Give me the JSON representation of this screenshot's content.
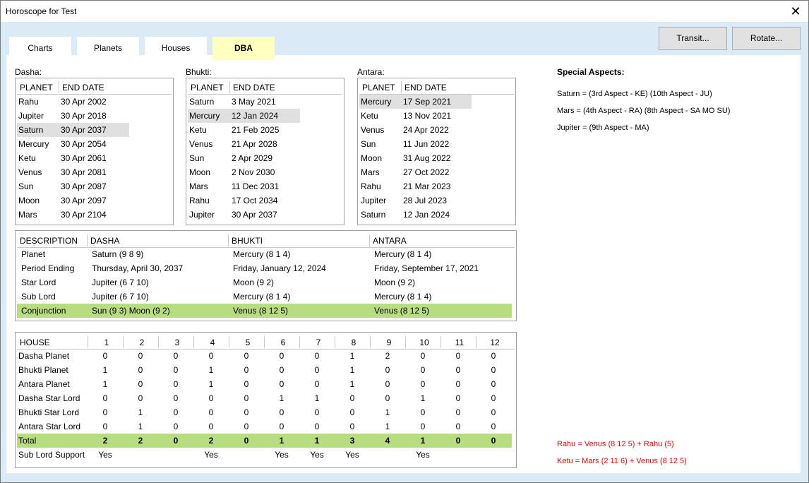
{
  "window": {
    "title": "Horoscope for Test",
    "close_icon": "close-icon"
  },
  "tabs": [
    {
      "label": "Charts"
    },
    {
      "label": "Planets"
    },
    {
      "label": "Houses"
    },
    {
      "label": "DBA",
      "active": true
    }
  ],
  "buttons": {
    "transit": "Transit...",
    "rotate": "Rotate..."
  },
  "colors": {
    "active_tab": "#ffffc0",
    "highlight_row": "#b8dc80",
    "selected_row": "#e0e0e0",
    "conjunction_text": "#ff0000"
  },
  "lists": [
    {
      "label": "Dasha:",
      "col1": "PLANET",
      "col2": "END DATE",
      "selected": 2,
      "rows": [
        [
          "Rahu",
          "30 Apr 2002"
        ],
        [
          "Jupiter",
          "30 Apr 2018"
        ],
        [
          "Saturn",
          "30 Apr 2037"
        ],
        [
          "Mercury",
          "30 Apr 2054"
        ],
        [
          "Ketu",
          "30 Apr 2061"
        ],
        [
          "Venus",
          "30 Apr 2081"
        ],
        [
          "Sun",
          "30 Apr 2087"
        ],
        [
          "Moon",
          "30 Apr 2097"
        ],
        [
          "Mars",
          "30 Apr 2104"
        ]
      ]
    },
    {
      "label": "Bhukti:",
      "col1": "PLANET",
      "col2": "END DATE",
      "selected": 1,
      "rows": [
        [
          "Saturn",
          "3 May 2021"
        ],
        [
          "Mercury",
          "12 Jan 2024"
        ],
        [
          "Ketu",
          "21 Feb 2025"
        ],
        [
          "Venus",
          "21 Apr 2028"
        ],
        [
          "Sun",
          "2 Apr 2029"
        ],
        [
          "Moon",
          "2 Nov 2030"
        ],
        [
          "Mars",
          "11 Dec 2031"
        ],
        [
          "Rahu",
          "17 Oct 2034"
        ],
        [
          "Jupiter",
          "30 Apr 2037"
        ]
      ]
    },
    {
      "label": "Antara:",
      "col1": "PLANET",
      "col2": "END DATE",
      "selected": 0,
      "rows": [
        [
          "Mercury",
          "17 Sep 2021"
        ],
        [
          "Ketu",
          "13 Nov 2021"
        ],
        [
          "Venus",
          "24 Apr 2022"
        ],
        [
          "Sun",
          "11 Jun 2022"
        ],
        [
          "Moon",
          "31 Aug 2022"
        ],
        [
          "Mars",
          "27 Oct 2022"
        ],
        [
          "Rahu",
          "21 Mar 2023"
        ],
        [
          "Jupiter",
          "28 Jul 2023"
        ],
        [
          "Saturn",
          "12 Jan 2024"
        ]
      ]
    }
  ],
  "description": {
    "headers": [
      "DESCRIPTION",
      "DASHA",
      "BHUKTI",
      "ANTARA"
    ],
    "rows": [
      [
        "Planet",
        "Saturn (9 8 9)",
        "Mercury (8 1 4)",
        "Mercury (8 1 4)"
      ],
      [
        "Period Ending",
        "Thursday, April 30, 2037",
        "Friday, January 12, 2024",
        "Friday, September 17, 2021"
      ],
      [
        "Star Lord",
        "Jupiter (6 7 10)",
        "Moon (9 2)",
        "Moon (9 2)"
      ],
      [
        "Sub Lord",
        "Jupiter (6 7 10)",
        "Mercury (8 1 4)",
        "Mercury (8 1 4)"
      ],
      [
        "Conjunction",
        "Sun (9 3) Moon (9 2)",
        "Venus (8 12 5)",
        "Venus (8 12 5)"
      ]
    ],
    "highlight_row": 4
  },
  "houses": {
    "headers": [
      "HOUSE",
      "1",
      "2",
      "3",
      "4",
      "5",
      "6",
      "7",
      "8",
      "9",
      "10",
      "11",
      "12"
    ],
    "rows": [
      [
        "Dasha Planet",
        "0",
        "0",
        "0",
        "0",
        "0",
        "0",
        "0",
        "1",
        "2",
        "0",
        "0",
        "0"
      ],
      [
        "Bhukti Planet",
        "1",
        "0",
        "0",
        "1",
        "0",
        "0",
        "0",
        "1",
        "0",
        "0",
        "0",
        "0"
      ],
      [
        "Antara Planet",
        "1",
        "0",
        "0",
        "1",
        "0",
        "0",
        "0",
        "1",
        "0",
        "0",
        "0",
        "0"
      ],
      [
        "Dasha Star Lord",
        "0",
        "0",
        "0",
        "0",
        "0",
        "1",
        "1",
        "0",
        "0",
        "1",
        "0",
        "0"
      ],
      [
        "Bhukti Star Lord",
        "0",
        "1",
        "0",
        "0",
        "0",
        "0",
        "0",
        "0",
        "1",
        "0",
        "0",
        "0"
      ],
      [
        "Antara Star Lord",
        "0",
        "1",
        "0",
        "0",
        "0",
        "0",
        "0",
        "0",
        "1",
        "0",
        "0",
        "0"
      ],
      [
        "Total",
        "2",
        "2",
        "0",
        "2",
        "0",
        "1",
        "1",
        "3",
        "4",
        "1",
        "0",
        "0"
      ],
      [
        "Sub Lord Support",
        "Yes",
        "",
        "",
        "Yes",
        "",
        "Yes",
        "Yes",
        "Yes",
        "",
        "Yes",
        "",
        ""
      ]
    ],
    "total_row": 6
  },
  "special_aspects": {
    "title": "Special Aspects:",
    "lines": [
      "Saturn = (3rd Aspect - KE) (10th Aspect - JU)",
      "Mars = (4th Aspect - RA) (8th Aspect - SA MO SU)",
      "Jupiter = (9th Aspect - MA)"
    ]
  },
  "conjunctions": [
    "Rahu = Venus (8 12 5) + Rahu (5)",
    "Ketu = Mars (2 11 6) + Venus (8 12 5)"
  ]
}
